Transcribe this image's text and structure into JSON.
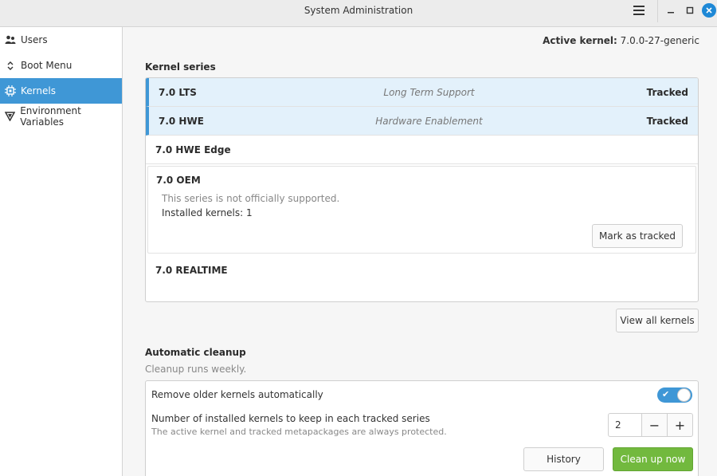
{
  "window": {
    "title": "System Administration"
  },
  "icons": {
    "menu": "hamburger-menu-icon",
    "minimize": "minimize-icon",
    "maximize": "maximize-icon",
    "close": "close-icon"
  },
  "colors": {
    "accent": "#3f97d6",
    "primary_action": "#72b93e",
    "close_button": "#1e88d6"
  },
  "sidebar": {
    "items": [
      {
        "label": "Users",
        "icon": "users-icon",
        "active": false
      },
      {
        "label": "Boot Menu",
        "icon": "boot-menu-icon",
        "active": false
      },
      {
        "label": "Kernels",
        "icon": "chip-icon",
        "active": true
      },
      {
        "label": "Environment Variables",
        "icon": "variable-icon",
        "active": false
      }
    ]
  },
  "header": {
    "active_kernel_label": "Active kernel:",
    "active_kernel_value": "7.0.0-27-generic"
  },
  "kernel_series": {
    "title": "Kernel series",
    "rows": [
      {
        "name": "7.0 LTS",
        "description": "Long Term Support",
        "status": "Tracked",
        "tracked": true
      },
      {
        "name": "7.0 HWE",
        "description": "Hardware Enablement",
        "status": "Tracked",
        "tracked": true
      },
      {
        "name": "7.0 HWE Edge",
        "description": "",
        "status": "",
        "tracked": false
      }
    ],
    "oem": {
      "name": "7.0 OEM",
      "note": "This series is not officially supported.",
      "installed": "Installed kernels: 1",
      "button": "Mark as tracked"
    },
    "realtime": {
      "name": "7.0 REALTIME"
    },
    "view_all_button": "View all kernels"
  },
  "cleanup": {
    "title": "Automatic cleanup",
    "subtitle": "Cleanup runs weekly.",
    "auto_remove_label": "Remove older kernels automatically",
    "auto_remove_enabled": true,
    "keep_label": "Number of installed kernels to keep in each tracked series",
    "keep_hint": "The active kernel and tracked metapackages are always protected.",
    "keep_value": "2",
    "minus": "−",
    "plus": "+",
    "history_button": "History",
    "cleanup_button": "Clean up now"
  }
}
